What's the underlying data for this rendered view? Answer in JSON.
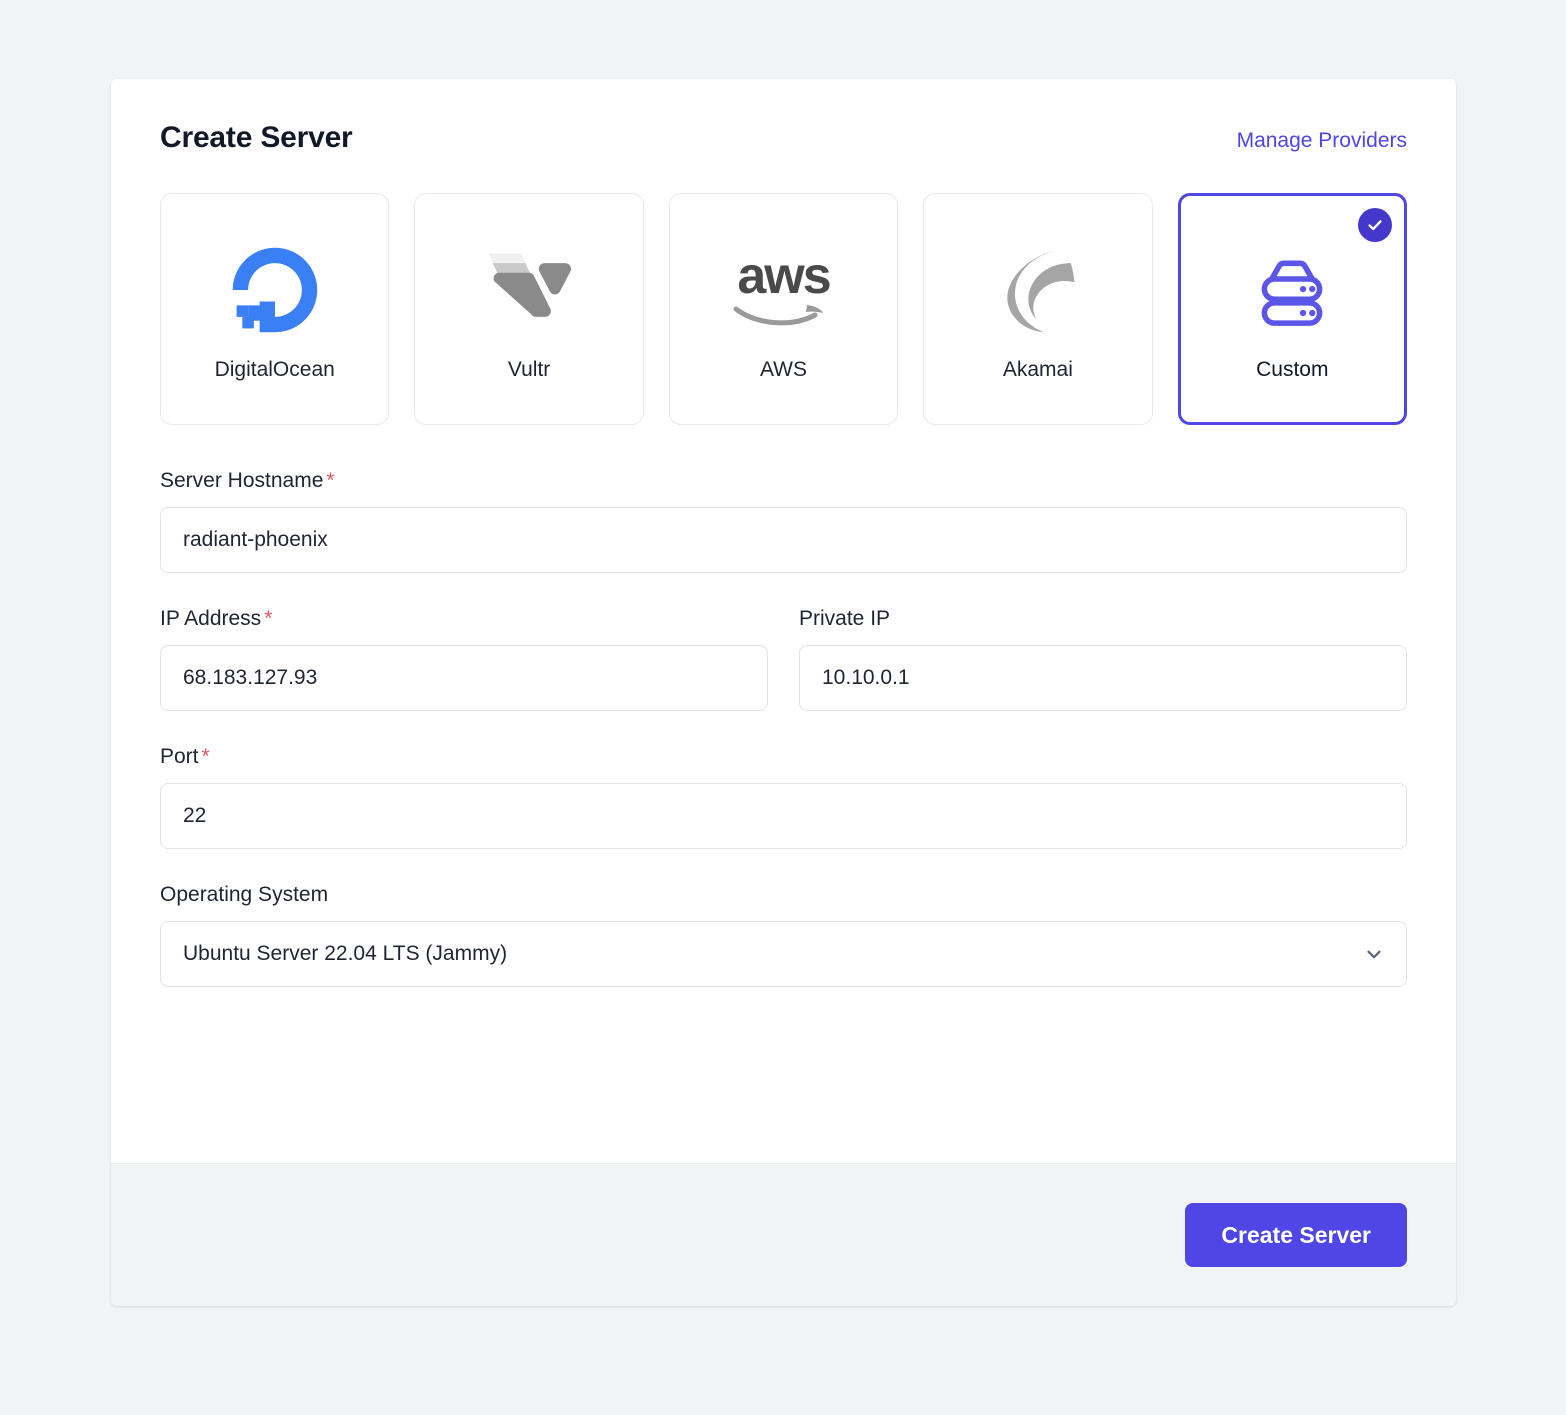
{
  "header": {
    "title": "Create Server",
    "manage_link": "Manage Providers"
  },
  "providers": [
    {
      "label": "DigitalOcean",
      "icon": "digitalocean-logo",
      "selected": false
    },
    {
      "label": "Vultr",
      "icon": "vultr-logo",
      "selected": false
    },
    {
      "label": "AWS",
      "icon": "aws-logo",
      "wordmark": "aws",
      "selected": false
    },
    {
      "label": "Akamai",
      "icon": "akamai-logo",
      "selected": false
    },
    {
      "label": "Custom",
      "icon": "server-stack-icon",
      "selected": true
    }
  ],
  "form": {
    "hostname": {
      "label": "Server Hostname",
      "required": "*",
      "value": "radiant-phoenix",
      "placeholder": "Server Hostname"
    },
    "ip_address": {
      "label": "IP Address",
      "required": "*",
      "value": "68.183.127.93",
      "placeholder": "IP Address"
    },
    "private_ip": {
      "label": "Private IP",
      "value": "10.10.0.1",
      "placeholder": "Private IP"
    },
    "port": {
      "label": "Port",
      "required": "*",
      "value": "22",
      "placeholder": "Port"
    },
    "operating_system": {
      "label": "Operating System",
      "value": "Ubuntu Server 22.04 LTS (Jammy)",
      "icon": "chevron-down-icon"
    }
  },
  "footer": {
    "submit_label": "Create Server"
  },
  "colors": {
    "accent": "#4f46e5",
    "accent_dark": "#4338ca",
    "required": "#e25563",
    "digitalocean_blue": "#3b7ff5",
    "vultr_gray": "#8a8a8a",
    "akamai_gray": "#a5a5a5",
    "page_background": "#f1f3f5",
    "card_background": "#ffffff",
    "footer_background": "#f1f3f5"
  }
}
